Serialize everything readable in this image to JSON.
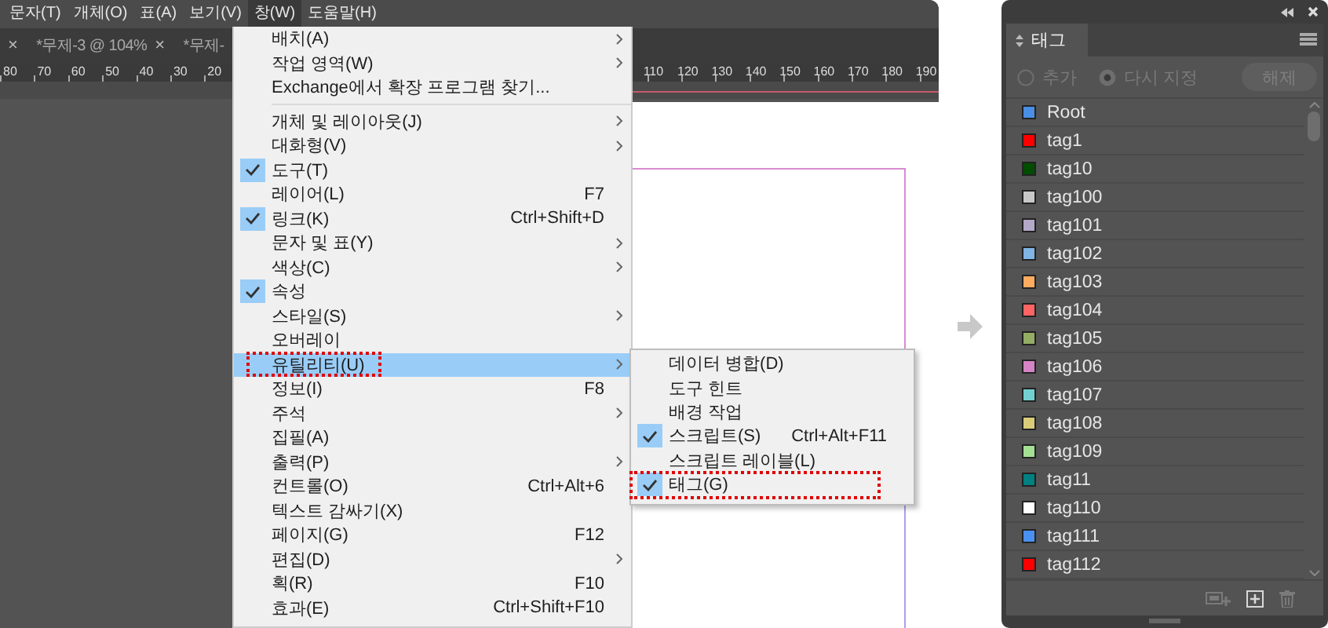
{
  "menubar": [
    {
      "label": "문자(T)",
      "selected": false
    },
    {
      "label": "개체(O)",
      "selected": false
    },
    {
      "label": "표(A)",
      "selected": false
    },
    {
      "label": "보기(V)",
      "selected": false
    },
    {
      "label": "창(W)",
      "selected": true
    },
    {
      "label": "도움말(H)",
      "selected": false
    }
  ],
  "document_tabs": [
    {
      "close": "×"
    },
    {
      "label": "*무제-3 @ 104%",
      "close": "×"
    },
    {
      "label": "*무제-"
    }
  ],
  "ruler": {
    "left_labels": [
      "80",
      "70",
      "60",
      "50",
      "40",
      "30",
      "20"
    ],
    "right_labels": [
      "110",
      "120",
      "130",
      "140",
      "150",
      "160",
      "170",
      "180",
      "190"
    ]
  },
  "window_menu": {
    "items": [
      {
        "kind": "item",
        "label": "배치(A)",
        "submenu": true,
        "checked": false,
        "selected": false,
        "annotated": false
      },
      {
        "kind": "item",
        "label": "작업 영역(W)",
        "submenu": true,
        "checked": false,
        "selected": false,
        "annotated": false
      },
      {
        "kind": "item",
        "label": "Exchange에서 확장 프로그램 찾기...",
        "submenu": false,
        "checked": false,
        "selected": false,
        "annotated": false
      },
      {
        "kind": "separator"
      },
      {
        "kind": "item",
        "label": "개체 및 레이아웃(J)",
        "submenu": true,
        "checked": false,
        "selected": false,
        "annotated": false
      },
      {
        "kind": "item",
        "label": "대화형(V)",
        "submenu": true,
        "checked": false,
        "selected": false,
        "annotated": false
      },
      {
        "kind": "item",
        "label": "도구(T)",
        "submenu": false,
        "checked": true,
        "selected": false,
        "annotated": false
      },
      {
        "kind": "item",
        "label": "레이어(L)",
        "shortcut": "F7",
        "submenu": false,
        "checked": false,
        "selected": false,
        "annotated": false
      },
      {
        "kind": "item",
        "label": "링크(K)",
        "shortcut": "Ctrl+Shift+D",
        "submenu": false,
        "checked": true,
        "selected": false,
        "annotated": false
      },
      {
        "kind": "item",
        "label": "문자 및 표(Y)",
        "submenu": true,
        "checked": false,
        "selected": false,
        "annotated": false
      },
      {
        "kind": "item",
        "label": "색상(C)",
        "submenu": true,
        "checked": false,
        "selected": false,
        "annotated": false
      },
      {
        "kind": "item",
        "label": "속성",
        "submenu": false,
        "checked": true,
        "selected": false,
        "annotated": false
      },
      {
        "kind": "item",
        "label": "스타일(S)",
        "submenu": true,
        "checked": false,
        "selected": false,
        "annotated": false
      },
      {
        "kind": "item",
        "label": "오버레이",
        "submenu": false,
        "checked": false,
        "selected": false,
        "annotated": false
      },
      {
        "kind": "item",
        "label": "유틸리티(U)",
        "submenu": true,
        "checked": false,
        "selected": true,
        "annotated": true
      },
      {
        "kind": "item",
        "label": "정보(I)",
        "shortcut": "F8",
        "submenu": false,
        "checked": false,
        "selected": false,
        "annotated": false
      },
      {
        "kind": "item",
        "label": "주석",
        "submenu": true,
        "checked": false,
        "selected": false,
        "annotated": false
      },
      {
        "kind": "item",
        "label": "집필(A)",
        "submenu": false,
        "checked": false,
        "selected": false,
        "annotated": false
      },
      {
        "kind": "item",
        "label": "출력(P)",
        "submenu": true,
        "checked": false,
        "selected": false,
        "annotated": false
      },
      {
        "kind": "item",
        "label": "컨트롤(O)",
        "shortcut": "Ctrl+Alt+6",
        "submenu": false,
        "checked": false,
        "selected": false,
        "annotated": false
      },
      {
        "kind": "item",
        "label": "텍스트 감싸기(X)",
        "submenu": false,
        "checked": false,
        "selected": false,
        "annotated": false
      },
      {
        "kind": "item",
        "label": "페이지(G)",
        "shortcut": "F12",
        "submenu": false,
        "checked": false,
        "selected": false,
        "annotated": false
      },
      {
        "kind": "item",
        "label": "편집(D)",
        "submenu": true,
        "checked": false,
        "selected": false,
        "annotated": false
      },
      {
        "kind": "item",
        "label": "획(R)",
        "shortcut": "F10",
        "submenu": false,
        "checked": false,
        "selected": false,
        "annotated": false
      },
      {
        "kind": "item",
        "label": "효과(E)",
        "shortcut": "Ctrl+Shift+F10",
        "submenu": false,
        "checked": false,
        "selected": false,
        "annotated": false
      }
    ]
  },
  "utility_submenu": {
    "items": [
      {
        "kind": "item",
        "label": "데이터 병합(D)",
        "submenu": false,
        "checked": false,
        "selected": false,
        "annotated": false
      },
      {
        "kind": "item",
        "label": "도구 힌트",
        "submenu": false,
        "checked": false,
        "selected": false,
        "annotated": false
      },
      {
        "kind": "item",
        "label": "배경 작업",
        "submenu": false,
        "checked": false,
        "selected": false,
        "annotated": false
      },
      {
        "kind": "item",
        "label": "스크립트(S)",
        "shortcut": "Ctrl+Alt+F11",
        "submenu": false,
        "checked": true,
        "selected": false,
        "annotated": false
      },
      {
        "kind": "item",
        "label": "스크립트 레이블(L)",
        "submenu": false,
        "checked": false,
        "selected": false,
        "annotated": false
      },
      {
        "kind": "item",
        "label": "태그(G)",
        "submenu": false,
        "checked": true,
        "selected": false,
        "annotated": true
      }
    ]
  },
  "tags_panel": {
    "title": "태그",
    "options": [
      {
        "label": "추가",
        "selected": false,
        "disabled": true
      },
      {
        "label": "다시 지정",
        "selected": true,
        "disabled": true
      }
    ],
    "release_button": {
      "label": "해제",
      "disabled": true
    },
    "tags": [
      {
        "name": "Root",
        "color": "#4a8ee6"
      },
      {
        "name": "tag1",
        "color": "#ff0000"
      },
      {
        "name": "tag10",
        "color": "#004d00"
      },
      {
        "name": "tag100",
        "color": "#c8c8c8"
      },
      {
        "name": "tag101",
        "color": "#b4a8c8"
      },
      {
        "name": "tag102",
        "color": "#80b4e4"
      },
      {
        "name": "tag103",
        "color": "#ffac60"
      },
      {
        "name": "tag104",
        "color": "#ff6464"
      },
      {
        "name": "tag105",
        "color": "#94ac64"
      },
      {
        "name": "tag106",
        "color": "#d484c4"
      },
      {
        "name": "tag107",
        "color": "#74d0d0"
      },
      {
        "name": "tag108",
        "color": "#d8cc78"
      },
      {
        "name": "tag109",
        "color": "#a4e094"
      },
      {
        "name": "tag11",
        "color": "#008080"
      },
      {
        "name": "tag110",
        "color": "#ffffff"
      },
      {
        "name": "tag111",
        "color": "#4a90f0"
      },
      {
        "name": "tag112",
        "color": "#ff0000"
      }
    ],
    "footer_buttons": [
      {
        "disabled": true
      },
      {
        "disabled": false
      },
      {
        "disabled": true
      }
    ]
  }
}
